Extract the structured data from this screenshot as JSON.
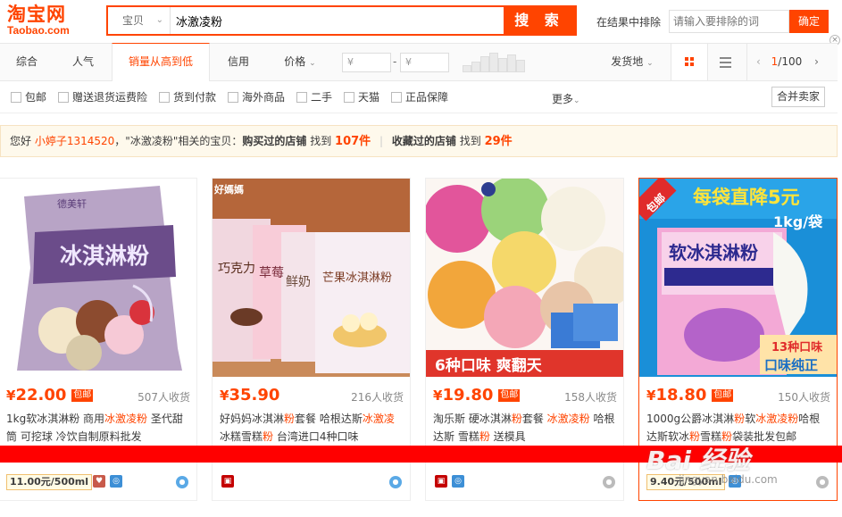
{
  "header": {
    "logo_cn": "淘宝网",
    "logo_en": "Taobao.com",
    "search_category": "宝贝",
    "search_query": "冰激凌粉",
    "search_button": "搜 索",
    "exclude_label": "在结果中排除",
    "exclude_placeholder": "请输入要排除的词",
    "exclude_button": "确定"
  },
  "sortbar": {
    "tabs": [
      "综合",
      "人气",
      "销量从高到低",
      "信用",
      "价格"
    ],
    "active_tab": "销量从高到低",
    "price_min_placeholder": "¥",
    "price_max_placeholder": "¥",
    "price_dash": "-",
    "ship_from": "发货地",
    "page_current": "1",
    "page_total": "/100"
  },
  "filters": {
    "items": [
      "包邮",
      "赠送退货运费险",
      "货到付款",
      "海外商品",
      "二手",
      "天猫",
      "正品保障"
    ],
    "more": "更多",
    "merge_sellers": "合并卖家"
  },
  "notice": {
    "greeting": "您好",
    "username": "小婷子1314520",
    "query_part": "，\"冰激凌粉\"相关的宝贝：",
    "bought_label": "购买过的店铺",
    "found1": "找到",
    "count1": "107件",
    "fav_label": "收藏过的店铺",
    "found2": "找到",
    "count2": "29件"
  },
  "items": [
    {
      "price": "22.00",
      "yen": "¥",
      "baoyou": "包邮",
      "sales": "507人收货",
      "title_parts": [
        "1kg软冰淇淋粉 商用",
        "冰激凌粉",
        " 圣代甜筒 可挖球 冷饮自制原料批发"
      ],
      "unit_price": "11.00元/500ml",
      "image_label": "冰淇淋粉",
      "image_brand": "德美轩"
    },
    {
      "price": "35.90",
      "yen": "¥",
      "baoyou": "",
      "sales": "216人收货",
      "title_parts": [
        "好妈妈冰淇淋",
        "粉",
        "套餐 哈根达斯",
        "冰激凌",
        "冰糕雪糕",
        "粉",
        " 台湾进口4种口味"
      ],
      "unit_price": "",
      "image_label": "芒果冰淇淋粉",
      "image_brand": "好媽媽",
      "image_boxes": [
        "巧克力",
        "草莓",
        "鲜奶"
      ]
    },
    {
      "price": "19.80",
      "yen": "¥",
      "baoyou": "包邮",
      "sales": "158人收货",
      "title_parts": [
        "淘乐斯 硬冰淇淋",
        "粉",
        "套餐 ",
        "冰激凌粉",
        " 哈根达斯 雪糕",
        "粉",
        " 送模具"
      ],
      "unit_price": "",
      "image_label": "6种口味  爽翻天"
    },
    {
      "price": "18.80",
      "yen": "¥",
      "baoyou": "包邮",
      "sales": "150人收货",
      "title_parts": [
        "1000g公爵冰淇淋",
        "粉",
        "软",
        "冰激凌粉",
        "哈根达斯软冰",
        "粉",
        "雪糕",
        "粉",
        "袋装批发包邮"
      ],
      "unit_price": "9.40元/500ml",
      "image_banner": "每袋直降5元",
      "image_weight": "1kg/袋",
      "image_badge": "包邮",
      "image_label": "软冰淇淋粉",
      "image_sub": "13种口味",
      "image_sub2": "口味纯正"
    }
  ],
  "watermark": {
    "main": "Bai  经验",
    "sub": "jingyan.baidu.com"
  }
}
